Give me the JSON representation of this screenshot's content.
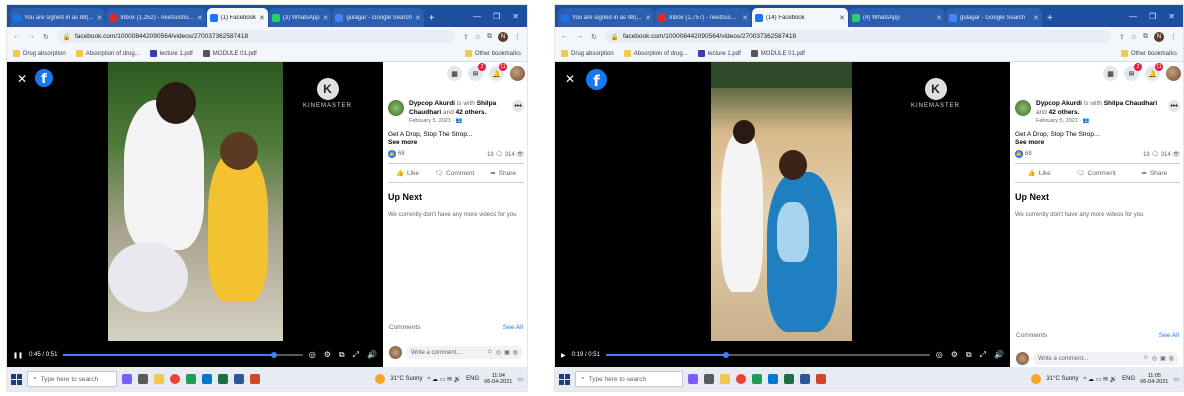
{
  "screens": [
    {
      "tabs": [
        {
          "label": "You are signed in as 88(...",
          "color": "#1a73e8",
          "active": false
        },
        {
          "label": "Inbox (1,252) - neetsusho...",
          "color": "#d93025",
          "active": false
        },
        {
          "label": "(1) Facebook",
          "color": "#1877f2",
          "active": true
        },
        {
          "label": "(3) WhatsApp",
          "color": "#25d366",
          "active": false
        },
        {
          "label": "gulagar - Google Search",
          "color": "#4285f4",
          "active": false
        }
      ],
      "url": "facebook.com/100008442090564/videos/270037362587418",
      "bookmarks": [
        "Drug absorption",
        "Absorption of drug...",
        "lecture 1.pdf",
        "MODULE 01.pdf"
      ],
      "other_bookmarks": "Other bookmarks",
      "kinemaster": "KINEMASTER",
      "time": "0:45 / 0:51",
      "progress": 0.88
    },
    {
      "tabs": [
        {
          "label": "You are signed in as 98(...",
          "color": "#1a73e8",
          "active": false
        },
        {
          "label": "Inbox (1,757) - neetsusho...",
          "color": "#d93025",
          "active": false
        },
        {
          "label": "(14) Facebook",
          "color": "#1877f2",
          "active": true
        },
        {
          "label": "(4) WhatsApp",
          "color": "#25d366",
          "active": false
        },
        {
          "label": "gulagar - Google Search",
          "color": "#4285f4",
          "active": false
        }
      ],
      "url": "facebook.com/100008442090564/videos/270037362587418",
      "bookmarks": [
        "Drug absorption",
        "Absorption of drug...",
        "lecture 1.pdf",
        "MODULE 01.pdf"
      ],
      "other_bookmarks": "Other bookmarks",
      "kinemaster": "KINEMASTER",
      "time": "0:19 / 0:51",
      "progress": 0.37
    }
  ],
  "post": {
    "author": "Dypcop Akurdi",
    "with_text": "is with",
    "tagged": "Shilpa Chaudhari",
    "and_text": "and",
    "others": "42 others.",
    "date": "February 5, 2021 · ",
    "text": "Get A Drop, Stop The Strop...",
    "see_more": "See more",
    "reactions": "68",
    "comments_count": "18",
    "views": "314",
    "like": "Like",
    "comment": "Comment",
    "share": "Share",
    "up_next": "Up Next",
    "no_more": "We currently don't have any more videos for you",
    "comments_label": "Comments",
    "see_all": "See All",
    "write_placeholder": "Write a comment..."
  },
  "notifications": {
    "messenger": "2",
    "bell": "11"
  },
  "taskbar": {
    "search": "Type here to search",
    "weather": "31°C Sunny",
    "lang": "ENG",
    "time_left": "11:04",
    "time_right": "11:05",
    "date": "06-04-2021"
  },
  "colors": {
    "fb_blue": "#1877f2",
    "chrome_tab": "#1d4f9e"
  }
}
